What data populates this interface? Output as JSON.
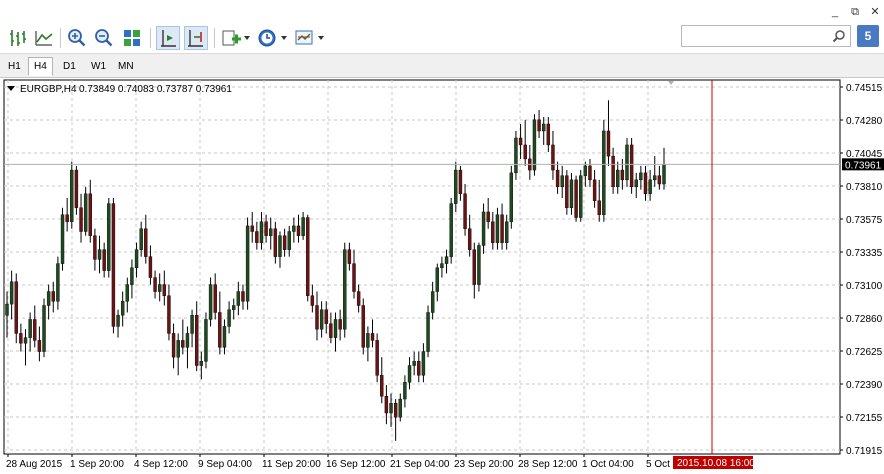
{
  "window": {
    "controls": [
      "_",
      "⧉",
      "✕"
    ]
  },
  "toolbar": {
    "buttons": [
      "bar-chart-icon",
      "candlestick-icon",
      "zoom-in-icon",
      "zoom-out-icon",
      "tile-windows-icon",
      "chart-shift-icon",
      "autoscroll-icon",
      "add-indicator-icon",
      "periodicity-icon",
      "templates-icon"
    ]
  },
  "search": {
    "placeholder": "",
    "value": ""
  },
  "notifications": {
    "count": "5"
  },
  "timeframes": [
    {
      "label": "H1",
      "active": false
    },
    {
      "label": "H4",
      "active": true
    },
    {
      "label": "D1",
      "active": false
    },
    {
      "label": "W1",
      "active": false
    },
    {
      "label": "MN",
      "active": false
    }
  ],
  "chart_data": {
    "type": "candlestick",
    "symbol": "EURGBP,H4",
    "ohlc_text": "0.73849 0.74083 0.73787 0.73961",
    "current_price": "0.73961",
    "y_ticks": [
      "0.74515",
      "0.74280",
      "0.74045",
      "0.73810",
      "0.73575",
      "0.73335",
      "0.73100",
      "0.72860",
      "0.72625",
      "0.72390",
      "0.72155",
      "0.71915"
    ],
    "ylim": [
      0.71915,
      0.74515
    ],
    "x_ticks": [
      "28 Aug 2015",
      "1 Sep 20:00",
      "4 Sep 12:00",
      "9 Sep 04:00",
      "11 Sep 20:00",
      "16 Sep 12:00",
      "21 Sep 04:00",
      "23 Sep 20:00",
      "28 Sep 12:00",
      "1 Oct 04:00",
      "5 Oct 2"
    ],
    "cursor_time": "2015.10.08 16:00",
    "grid": true,
    "colors": {
      "bull": "#1f4a1f",
      "bear": "#6b1212",
      "wick": "#000000",
      "cursor": "#c00000",
      "grid": "#c8c8c8"
    },
    "candles": [
      [
        0.7288,
        0.7305,
        0.7272,
        0.7296
      ],
      [
        0.7296,
        0.732,
        0.7285,
        0.7312
      ],
      [
        0.7312,
        0.7318,
        0.7268,
        0.7275
      ],
      [
        0.7275,
        0.7282,
        0.7262,
        0.7268
      ],
      [
        0.7268,
        0.7278,
        0.7252,
        0.7272
      ],
      [
        0.7272,
        0.729,
        0.7262,
        0.7285
      ],
      [
        0.7285,
        0.7295,
        0.7265,
        0.727
      ],
      [
        0.727,
        0.728,
        0.7255,
        0.7262
      ],
      [
        0.7262,
        0.73,
        0.7258,
        0.7295
      ],
      [
        0.7295,
        0.731,
        0.7285,
        0.7305
      ],
      [
        0.7305,
        0.7312,
        0.729,
        0.7298
      ],
      [
        0.7298,
        0.733,
        0.7292,
        0.7325
      ],
      [
        0.7325,
        0.7365,
        0.732,
        0.736
      ],
      [
        0.736,
        0.7372,
        0.7348,
        0.7355
      ],
      [
        0.7355,
        0.7398,
        0.735,
        0.7392
      ],
      [
        0.7392,
        0.7395,
        0.736,
        0.7365
      ],
      [
        0.7365,
        0.7375,
        0.734,
        0.7348
      ],
      [
        0.7348,
        0.738,
        0.7345,
        0.7375
      ],
      [
        0.7375,
        0.7385,
        0.734,
        0.7345
      ],
      [
        0.7345,
        0.735,
        0.732,
        0.7328
      ],
      [
        0.7328,
        0.7345,
        0.7318,
        0.7335
      ],
      [
        0.7335,
        0.734,
        0.7315,
        0.732
      ],
      [
        0.732,
        0.7372,
        0.7315,
        0.7368
      ],
      [
        0.7368,
        0.7372,
        0.7275,
        0.728
      ],
      [
        0.728,
        0.7292,
        0.7272,
        0.7288
      ],
      [
        0.7288,
        0.7305,
        0.728,
        0.7298
      ],
      [
        0.7298,
        0.7315,
        0.729,
        0.731
      ],
      [
        0.731,
        0.7328,
        0.73,
        0.7322
      ],
      [
        0.7322,
        0.734,
        0.7315,
        0.7335
      ],
      [
        0.7335,
        0.7355,
        0.733,
        0.735
      ],
      [
        0.735,
        0.736,
        0.7325,
        0.733
      ],
      [
        0.733,
        0.7338,
        0.731,
        0.7315
      ],
      [
        0.7315,
        0.732,
        0.73,
        0.7305
      ],
      [
        0.7305,
        0.7318,
        0.7298,
        0.731
      ],
      [
        0.731,
        0.732,
        0.7295,
        0.7302
      ],
      [
        0.7302,
        0.731,
        0.727,
        0.7275
      ],
      [
        0.7275,
        0.7282,
        0.725,
        0.7258
      ],
      [
        0.7258,
        0.7275,
        0.7245,
        0.727
      ],
      [
        0.727,
        0.7285,
        0.726,
        0.7265
      ],
      [
        0.7265,
        0.728,
        0.725,
        0.7275
      ],
      [
        0.7275,
        0.7292,
        0.7265,
        0.7288
      ],
      [
        0.7288,
        0.7298,
        0.7248,
        0.7252
      ],
      [
        0.7252,
        0.7262,
        0.7242,
        0.7255
      ],
      [
        0.7255,
        0.729,
        0.725,
        0.7285
      ],
      [
        0.7285,
        0.7315,
        0.728,
        0.731
      ],
      [
        0.731,
        0.7318,
        0.7285,
        0.729
      ],
      [
        0.729,
        0.7305,
        0.726,
        0.7265
      ],
      [
        0.7265,
        0.7285,
        0.726,
        0.728
      ],
      [
        0.728,
        0.7298,
        0.7275,
        0.7292
      ],
      [
        0.7292,
        0.73,
        0.7285,
        0.7295
      ],
      [
        0.7295,
        0.7312,
        0.7288,
        0.7305
      ],
      [
        0.7305,
        0.731,
        0.7292,
        0.7298
      ],
      [
        0.7298,
        0.7358,
        0.7292,
        0.7352
      ],
      [
        0.7352,
        0.7362,
        0.734,
        0.7348
      ],
      [
        0.7348,
        0.7355,
        0.7335,
        0.734
      ],
      [
        0.734,
        0.7362,
        0.7335,
        0.7355
      ],
      [
        0.7355,
        0.736,
        0.734,
        0.7345
      ],
      [
        0.7345,
        0.7358,
        0.7335,
        0.735
      ],
      [
        0.735,
        0.7355,
        0.7325,
        0.733
      ],
      [
        0.733,
        0.7348,
        0.7322,
        0.7345
      ],
      [
        0.7345,
        0.735,
        0.733,
        0.7335
      ],
      [
        0.7335,
        0.7352,
        0.733,
        0.7348
      ],
      [
        0.7348,
        0.7358,
        0.734,
        0.7352
      ],
      [
        0.7352,
        0.736,
        0.734,
        0.7345
      ],
      [
        0.7345,
        0.7362,
        0.7342,
        0.7358
      ],
      [
        0.7358,
        0.736,
        0.7298,
        0.7302
      ],
      [
        0.7302,
        0.731,
        0.729,
        0.7295
      ],
      [
        0.7295,
        0.7305,
        0.727,
        0.7278
      ],
      [
        0.7278,
        0.7298,
        0.7272,
        0.7292
      ],
      [
        0.7292,
        0.7298,
        0.7275,
        0.7282
      ],
      [
        0.7282,
        0.729,
        0.7268,
        0.7272
      ],
      [
        0.7272,
        0.729,
        0.7262,
        0.7285
      ],
      [
        0.7285,
        0.7292,
        0.727,
        0.7278
      ],
      [
        0.7278,
        0.734,
        0.7272,
        0.7335
      ],
      [
        0.7335,
        0.734,
        0.732,
        0.7325
      ],
      [
        0.7325,
        0.7335,
        0.73,
        0.7305
      ],
      [
        0.7305,
        0.731,
        0.729,
        0.7295
      ],
      [
        0.7295,
        0.73,
        0.726,
        0.7265
      ],
      [
        0.7265,
        0.728,
        0.7255,
        0.7275
      ],
      [
        0.7275,
        0.7285,
        0.7265,
        0.727
      ],
      [
        0.727,
        0.7275,
        0.724,
        0.7245
      ],
      [
        0.7245,
        0.7258,
        0.7225,
        0.723
      ],
      [
        0.723,
        0.7238,
        0.721,
        0.7218
      ],
      [
        0.7218,
        0.7232,
        0.7208,
        0.7225
      ],
      [
        0.7225,
        0.7228,
        0.7198,
        0.7215
      ],
      [
        0.7215,
        0.7232,
        0.7212,
        0.7228
      ],
      [
        0.7228,
        0.7245,
        0.7222,
        0.724
      ],
      [
        0.724,
        0.7258,
        0.7235,
        0.7252
      ],
      [
        0.7252,
        0.7262,
        0.7245,
        0.7255
      ],
      [
        0.7255,
        0.7262,
        0.724,
        0.7245
      ],
      [
        0.7245,
        0.7268,
        0.724,
        0.7262
      ],
      [
        0.7262,
        0.7295,
        0.7258,
        0.729
      ],
      [
        0.729,
        0.7312,
        0.7285,
        0.7305
      ],
      [
        0.7305,
        0.7325,
        0.7298,
        0.7322
      ],
      [
        0.7322,
        0.733,
        0.7315,
        0.7325
      ],
      [
        0.7325,
        0.7335,
        0.7318,
        0.733
      ],
      [
        0.733,
        0.7372,
        0.7325,
        0.7368
      ],
      [
        0.7368,
        0.7398,
        0.7362,
        0.7392
      ],
      [
        0.7392,
        0.7395,
        0.737,
        0.7375
      ],
      [
        0.7375,
        0.7382,
        0.7345,
        0.735
      ],
      [
        0.735,
        0.736,
        0.733,
        0.7335
      ],
      [
        0.7335,
        0.734,
        0.73,
        0.731
      ],
      [
        0.731,
        0.734,
        0.7305,
        0.7338
      ],
      [
        0.7338,
        0.7368,
        0.7332,
        0.7362
      ],
      [
        0.7362,
        0.7372,
        0.735,
        0.7355
      ],
      [
        0.7355,
        0.7362,
        0.7335,
        0.734
      ],
      [
        0.734,
        0.7365,
        0.7335,
        0.736
      ],
      [
        0.736,
        0.7368,
        0.7335,
        0.734
      ],
      [
        0.734,
        0.736,
        0.7335,
        0.7355
      ],
      [
        0.7355,
        0.7395,
        0.735,
        0.739
      ],
      [
        0.739,
        0.742,
        0.7385,
        0.7415
      ],
      [
        0.7415,
        0.7425,
        0.74,
        0.741
      ],
      [
        0.741,
        0.7428,
        0.7395,
        0.74
      ],
      [
        0.74,
        0.741,
        0.7385,
        0.7392
      ],
      [
        0.7392,
        0.7432,
        0.7388,
        0.7428
      ],
      [
        0.7428,
        0.7435,
        0.7415,
        0.742
      ],
      [
        0.742,
        0.743,
        0.741,
        0.7425
      ],
      [
        0.7425,
        0.743,
        0.7405,
        0.741
      ],
      [
        0.741,
        0.742,
        0.7385,
        0.7392
      ],
      [
        0.7392,
        0.7398,
        0.7375,
        0.738
      ],
      [
        0.738,
        0.7395,
        0.7372,
        0.7388
      ],
      [
        0.7388,
        0.7392,
        0.736,
        0.7365
      ],
      [
        0.7365,
        0.739,
        0.736,
        0.7385
      ],
      [
        0.7385,
        0.7388,
        0.7355,
        0.7358
      ],
      [
        0.7358,
        0.7392,
        0.7355,
        0.7388
      ],
      [
        0.7388,
        0.7398,
        0.738,
        0.7395
      ],
      [
        0.7395,
        0.74,
        0.738,
        0.7385
      ],
      [
        0.7385,
        0.7392,
        0.7365,
        0.737
      ],
      [
        0.737,
        0.7385,
        0.7355,
        0.736
      ],
      [
        0.736,
        0.7428,
        0.7355,
        0.742
      ],
      [
        0.742,
        0.7442,
        0.7395,
        0.7402
      ],
      [
        0.7402,
        0.7408,
        0.7375,
        0.738
      ],
      [
        0.738,
        0.7398,
        0.7375,
        0.7392
      ],
      [
        0.7392,
        0.74,
        0.7378,
        0.7385
      ],
      [
        0.7385,
        0.7415,
        0.738,
        0.741
      ],
      [
        0.741,
        0.7415,
        0.7375,
        0.738
      ],
      [
        0.738,
        0.739,
        0.7372,
        0.7385
      ],
      [
        0.7385,
        0.7395,
        0.7378,
        0.739
      ],
      [
        0.739,
        0.7395,
        0.737,
        0.7375
      ],
      [
        0.7375,
        0.7392,
        0.737,
        0.7385
      ],
      [
        0.7385,
        0.7402,
        0.738,
        0.7388
      ],
      [
        0.7388,
        0.7395,
        0.7378,
        0.7382
      ],
      [
        0.7382,
        0.7408,
        0.7378,
        0.7396
      ]
    ]
  }
}
